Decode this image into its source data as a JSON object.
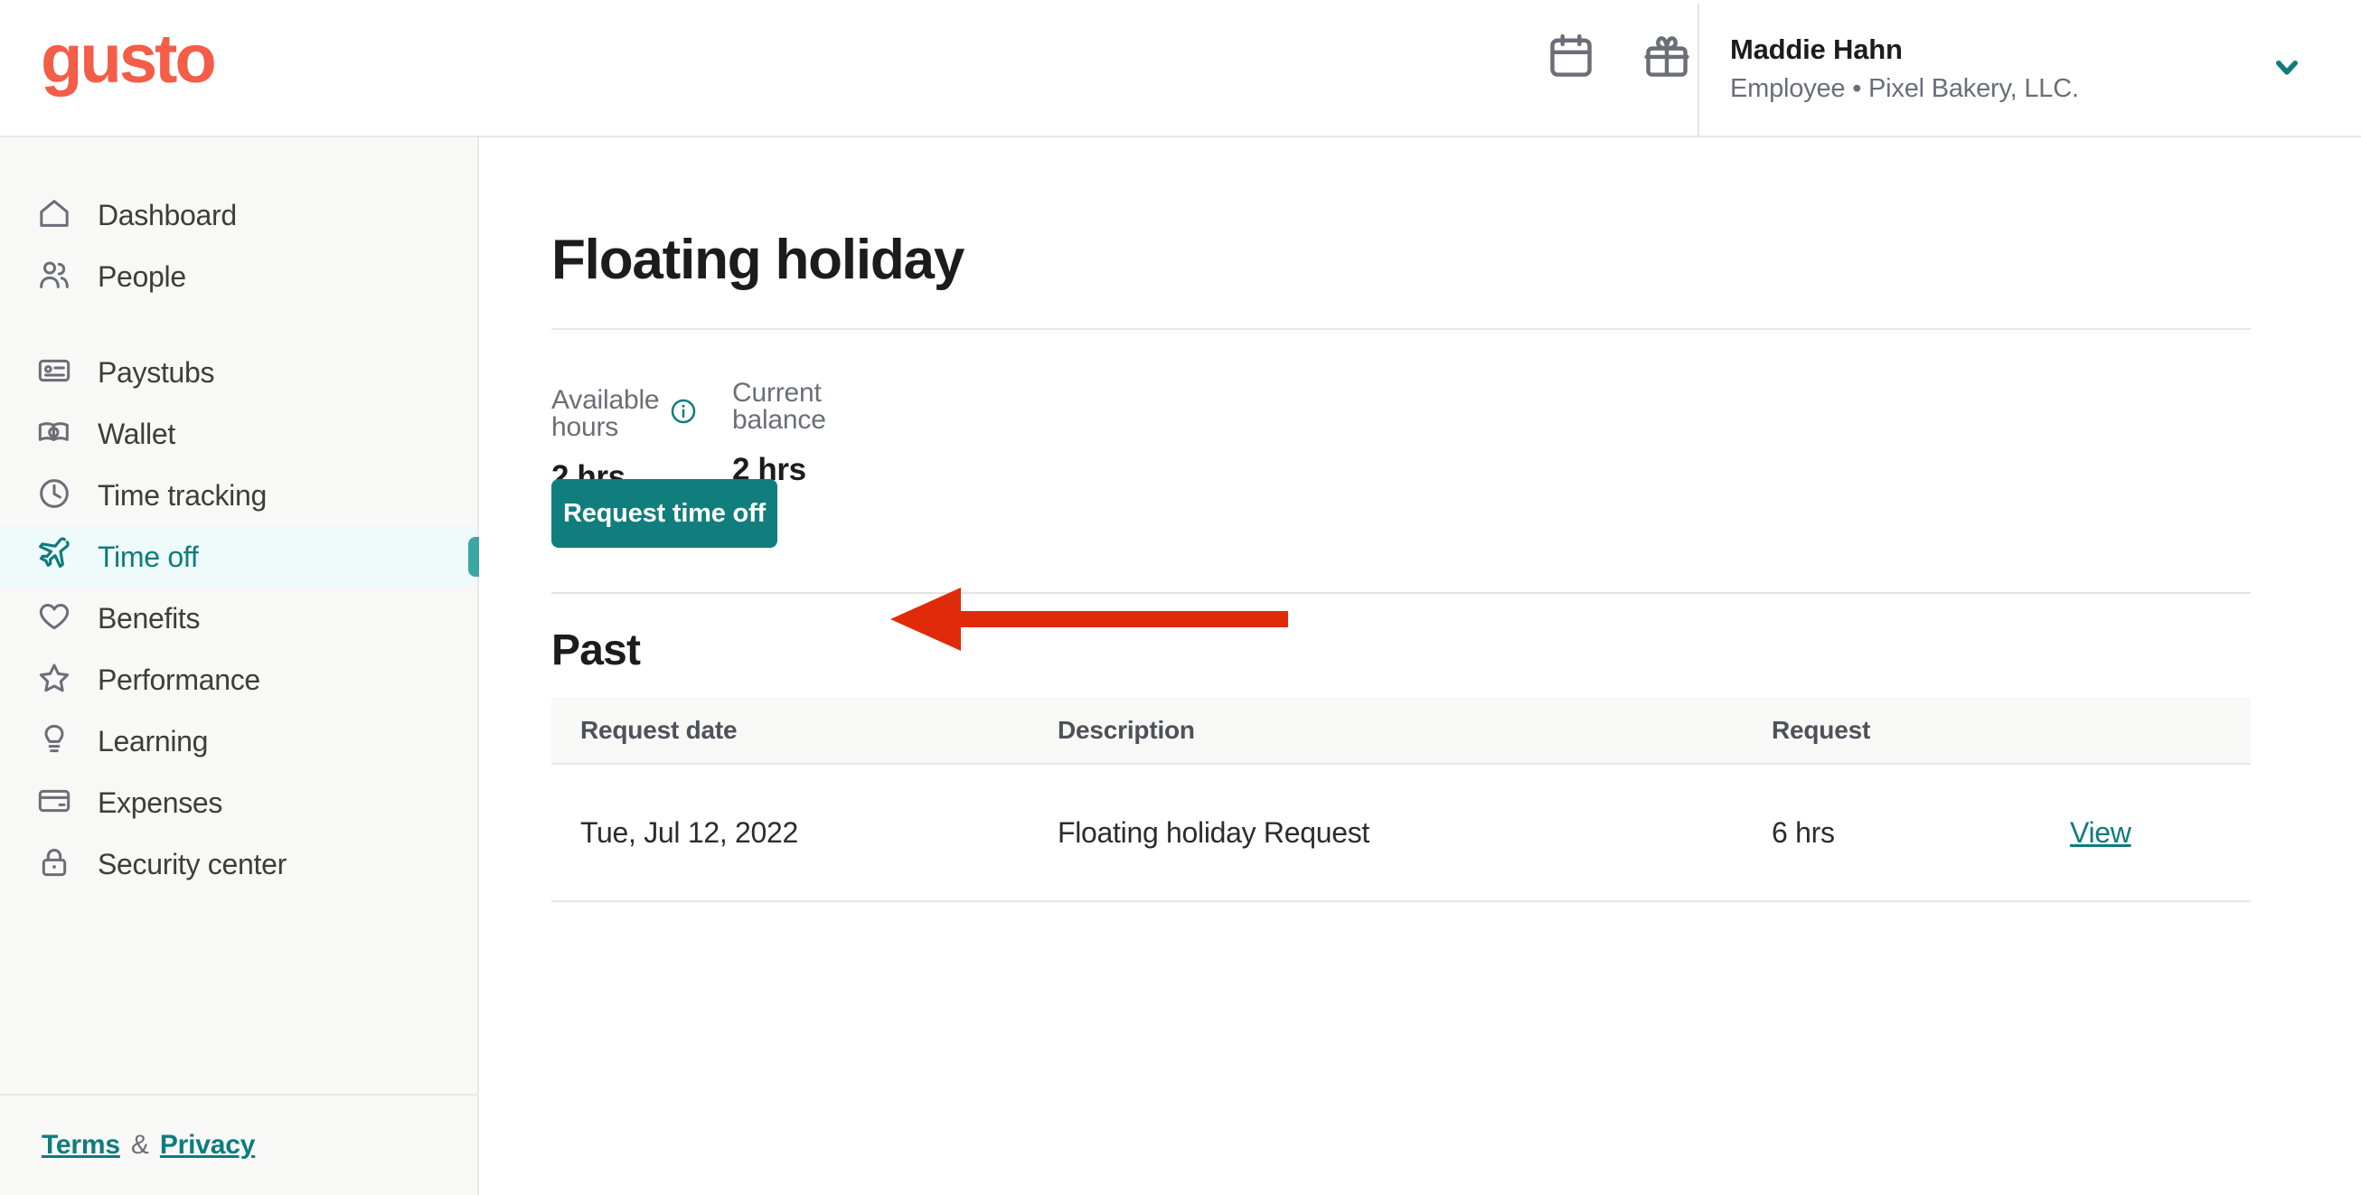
{
  "brand": {
    "logo_text": "gusto",
    "logo_color": "#f45d48",
    "accent_teal": "#0e7c7b",
    "annotation_red": "#e02b0a"
  },
  "header": {
    "icons": [
      {
        "name": "calendar-icon",
        "label": "Calendar"
      },
      {
        "name": "gift-icon",
        "label": "Gift"
      }
    ],
    "user": {
      "name": "Maddie Hahn",
      "subtitle": "Employee • Pixel Bakery, LLC.",
      "chevron": "chevron-down-icon"
    }
  },
  "sidebar": {
    "items": [
      {
        "label": "Dashboard",
        "icon": "home-icon",
        "active": false
      },
      {
        "label": "People",
        "icon": "people-icon",
        "active": false
      },
      {
        "label": "Paystubs",
        "icon": "paystub-card-icon",
        "active": false
      },
      {
        "label": "Wallet",
        "icon": "wallet-icon",
        "active": false
      },
      {
        "label": "Time tracking",
        "icon": "clock-icon",
        "active": false
      },
      {
        "label": "Time off",
        "icon": "airplane-icon",
        "active": true
      },
      {
        "label": "Benefits",
        "icon": "heart-icon",
        "active": false
      },
      {
        "label": "Performance",
        "icon": "star-icon",
        "active": false
      },
      {
        "label": "Learning",
        "icon": "lightbulb-icon",
        "active": false
      },
      {
        "label": "Expenses",
        "icon": "credit-card-icon",
        "active": false
      },
      {
        "label": "Security center",
        "icon": "lock-icon",
        "active": false
      }
    ],
    "footer": {
      "terms": "Terms",
      "amp": "&",
      "privacy": "Privacy"
    }
  },
  "main": {
    "page_title": "Floating holiday",
    "stats": [
      {
        "label": "Available hours",
        "value": "2 hrs",
        "has_info_icon": true
      },
      {
        "label": "Current balance",
        "value": "2 hrs",
        "has_info_icon": false
      }
    ],
    "request_button": "Request time off",
    "section_title": "Past",
    "table": {
      "columns": [
        "Request date",
        "Description",
        "Request",
        ""
      ],
      "rows": [
        {
          "request_date": "Tue, Jul 12, 2022",
          "description": "Floating holiday Request",
          "request": "6 hrs",
          "action": "View"
        }
      ]
    }
  },
  "annotation": {
    "type": "arrow",
    "points_to": "request-time-off-button",
    "color": "#e02b0a"
  }
}
